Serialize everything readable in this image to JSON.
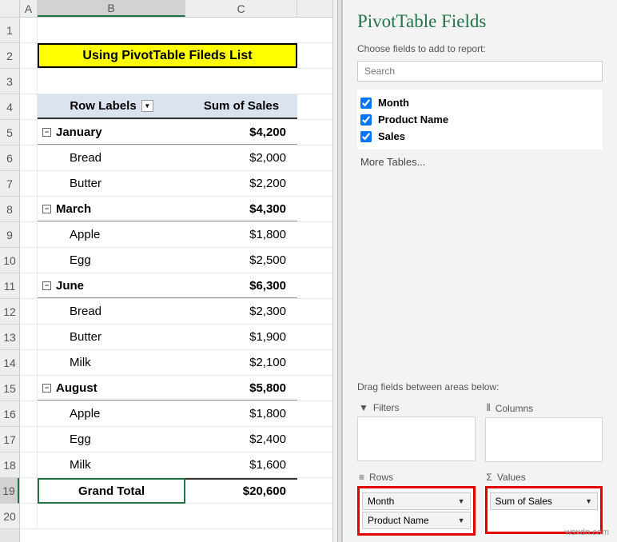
{
  "columns": {
    "A": "A",
    "B": "B",
    "C": "C"
  },
  "title": "Using PivotTable Fileds List",
  "pivot": {
    "row_labels": "Row Labels",
    "sum_label": "Sum of Sales",
    "grand_total_label": "Grand Total",
    "grand_total_value": "$20,600",
    "groups": [
      {
        "month": "January",
        "total": "$4,200",
        "items": [
          {
            "name": "Bread",
            "val": "$2,000"
          },
          {
            "name": "Butter",
            "val": "$2,200"
          }
        ]
      },
      {
        "month": "March",
        "total": "$4,300",
        "items": [
          {
            "name": "Apple",
            "val": "$1,800"
          },
          {
            "name": "Egg",
            "val": "$2,500"
          }
        ]
      },
      {
        "month": "June",
        "total": "$6,300",
        "items": [
          {
            "name": "Bread",
            "val": "$2,300"
          },
          {
            "name": "Butter",
            "val": "$1,900"
          },
          {
            "name": "Milk",
            "val": "$2,100"
          }
        ]
      },
      {
        "month": "August",
        "total": "$5,800",
        "items": [
          {
            "name": "Apple",
            "val": "$1,800"
          },
          {
            "name": "Egg",
            "val": "$2,400"
          },
          {
            "name": "Milk",
            "val": "$1,600"
          }
        ]
      }
    ]
  },
  "pane": {
    "title": "PivotTable Fields",
    "subtitle": "Choose fields to add to report:",
    "search_placeholder": "Search",
    "fields": [
      {
        "label": "Month",
        "checked": true
      },
      {
        "label": "Product Name",
        "checked": true
      },
      {
        "label": "Sales",
        "checked": true
      }
    ],
    "more_tables": "More Tables...",
    "drag_text": "Drag fields between areas below:",
    "areas": {
      "filters": {
        "label": "Filters",
        "items": []
      },
      "columns": {
        "label": "Columns",
        "items": []
      },
      "rows": {
        "label": "Rows",
        "items": [
          "Month",
          "Product Name"
        ]
      },
      "values": {
        "label": "Values",
        "items": [
          "Sum of Sales"
        ]
      }
    }
  },
  "watermark": "wsxdn.com"
}
